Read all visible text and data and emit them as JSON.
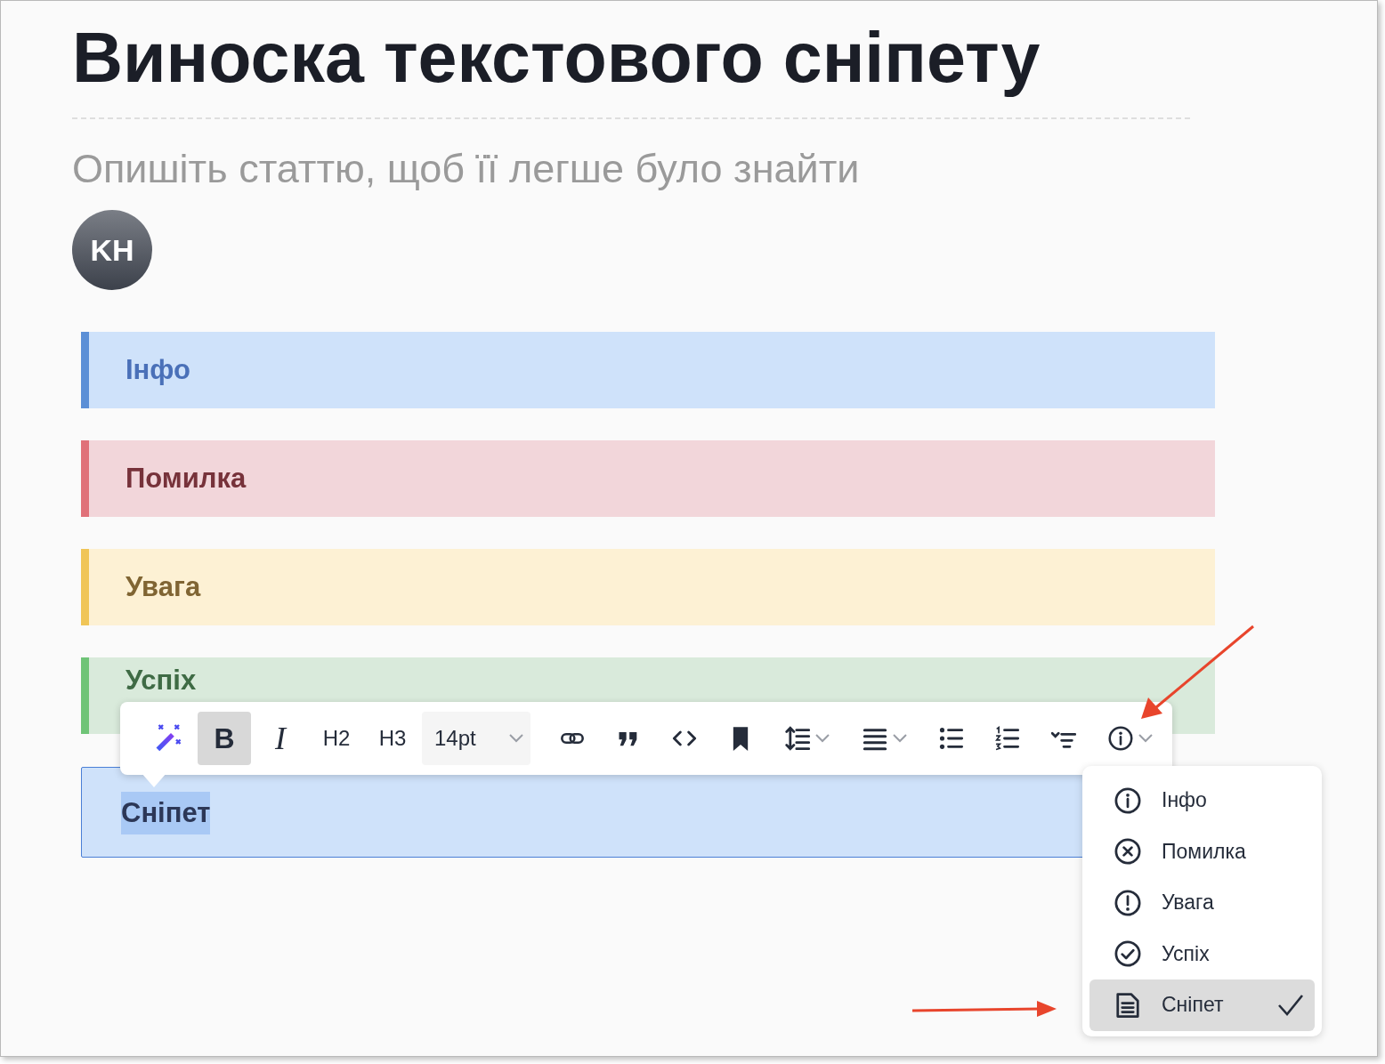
{
  "title": "Виноска текстового сніпету",
  "description": {
    "placeholder": "Опишіть статтю, щоб її легше було знайти"
  },
  "author": {
    "initials": "KH"
  },
  "callouts": [
    {
      "kind": "info",
      "text": "Інфо",
      "selected": false
    },
    {
      "kind": "error",
      "text": "Помилка",
      "selected": false
    },
    {
      "kind": "warning",
      "text": "Увага",
      "selected": false
    },
    {
      "kind": "success",
      "text": "Успіх",
      "selected": false
    },
    {
      "kind": "snippet",
      "text": "Сніпет",
      "selected": true
    }
  ],
  "toolbar": {
    "tools": [
      {
        "kind": "magic",
        "active": false,
        "menu": false
      },
      {
        "kind": "bold",
        "label": "B",
        "active": true,
        "menu": false
      },
      {
        "kind": "italic",
        "label": "I",
        "active": false,
        "menu": false
      },
      {
        "kind": "text",
        "label": "H2",
        "active": false,
        "menu": false
      },
      {
        "kind": "text",
        "label": "H3",
        "active": false,
        "menu": false
      },
      {
        "kind": "select",
        "value": "14pt"
      },
      {
        "kind": "link",
        "active": false,
        "menu": false
      },
      {
        "kind": "quote",
        "active": false,
        "menu": false
      },
      {
        "kind": "code",
        "active": false,
        "menu": false
      },
      {
        "kind": "bookmark",
        "active": false,
        "menu": false
      },
      {
        "kind": "line-height",
        "active": false,
        "menu": true
      },
      {
        "kind": "align",
        "active": false,
        "menu": true
      },
      {
        "kind": "bullets",
        "active": false,
        "menu": false
      },
      {
        "kind": "numbered",
        "active": false,
        "menu": false
      },
      {
        "kind": "collapse",
        "active": false,
        "menu": false
      },
      {
        "kind": "info",
        "active": false,
        "menu": true
      }
    ]
  },
  "callout_menu": {
    "items": [
      {
        "kind": "info",
        "label": "Інфо",
        "selected": false
      },
      {
        "kind": "error",
        "label": "Помилка",
        "selected": false
      },
      {
        "kind": "warning",
        "label": "Увага",
        "selected": false
      },
      {
        "kind": "success",
        "label": "Успіх",
        "selected": false
      },
      {
        "kind": "snippet",
        "label": "Сніпет",
        "selected": true
      }
    ]
  }
}
